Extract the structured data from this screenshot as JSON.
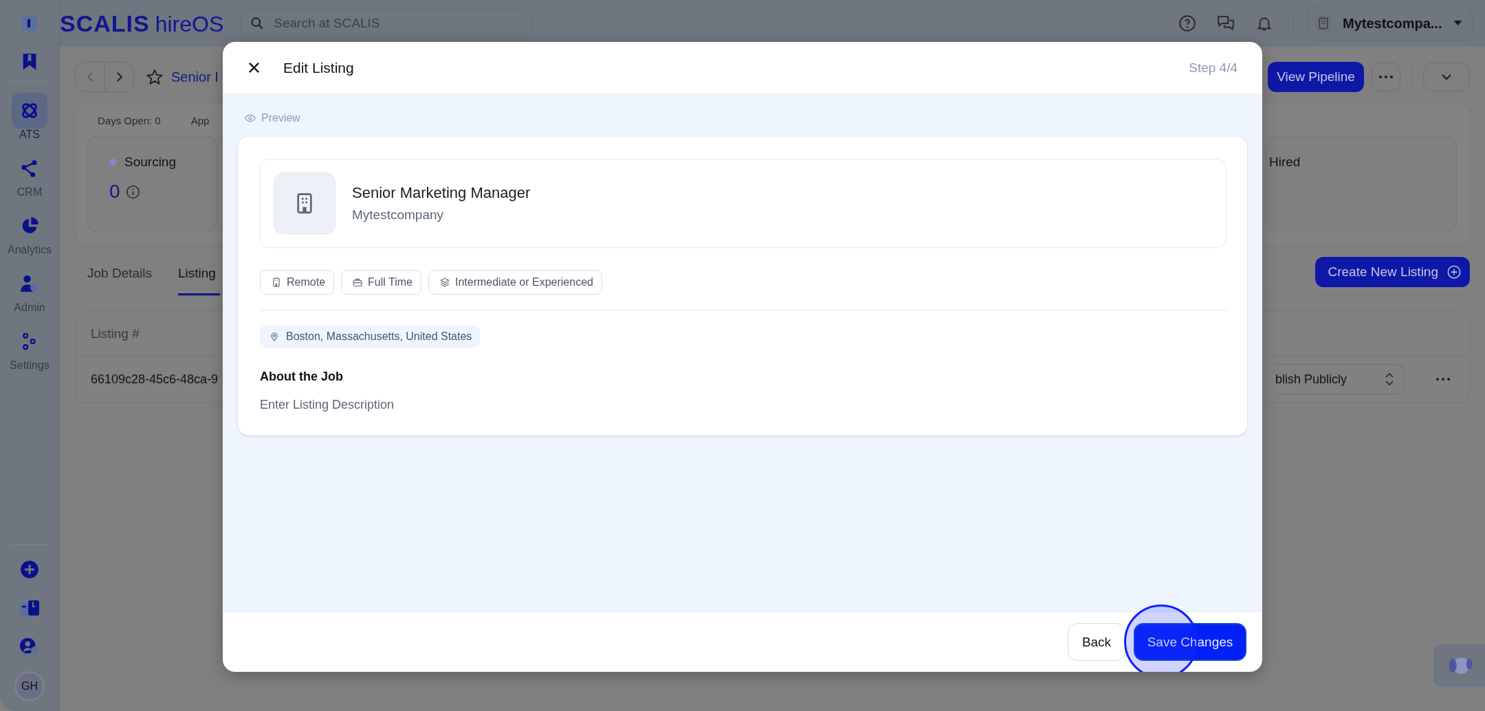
{
  "header": {
    "logo": "SCALIS",
    "product": "hireOS",
    "search": {
      "placeholder": "Search at SCALIS"
    },
    "company": "Mytestcompa..."
  },
  "sidebar": {
    "items": [
      {
        "label": "ATS",
        "selected": true
      },
      {
        "label": "CRM",
        "selected": false
      },
      {
        "label": "Analytics",
        "selected": false
      },
      {
        "label": "Admin",
        "selected": false
      },
      {
        "label": "Settings",
        "selected": false
      }
    ],
    "avatar": "GH"
  },
  "job": {
    "title": "Senior I",
    "primary_action": "View Pipeline",
    "stats": [
      "Days Open: 0",
      "App"
    ],
    "stages": [
      {
        "name": "Sourcing",
        "count": "0",
        "color": "#8e80d2"
      },
      {
        "name": "Hired"
      }
    ],
    "tabs": [
      {
        "label": "Job Details",
        "selected": false
      },
      {
        "label": "Listing",
        "selected": true
      }
    ],
    "create_button": "Create New Listing",
    "table": {
      "columns": [
        "Listing #"
      ],
      "rows": [
        {
          "cells": [
            "66109c28-45c6-48ca-9"
          ],
          "status": "blish Publicly"
        }
      ]
    }
  },
  "modal": {
    "title": "Edit Listing",
    "step": "Step 4/4",
    "preview_label": "Preview",
    "listing": {
      "title": "Senior Marketing Manager",
      "company": "Mytestcompany",
      "tags": [
        {
          "kind": "workplace",
          "label": "Remote"
        },
        {
          "kind": "schedule",
          "label": "Full Time"
        },
        {
          "kind": "level",
          "label": "Intermediate or Experienced"
        }
      ],
      "location": "Boston, Massachusetts, United States",
      "about_heading": "About the Job",
      "description": "Enter Listing Description"
    },
    "buttons": [
      {
        "kind": "secondary",
        "label": "Back",
        "highlighted": false
      },
      {
        "kind": "primary",
        "label": "Save Changes",
        "highlighted": true
      }
    ]
  }
}
